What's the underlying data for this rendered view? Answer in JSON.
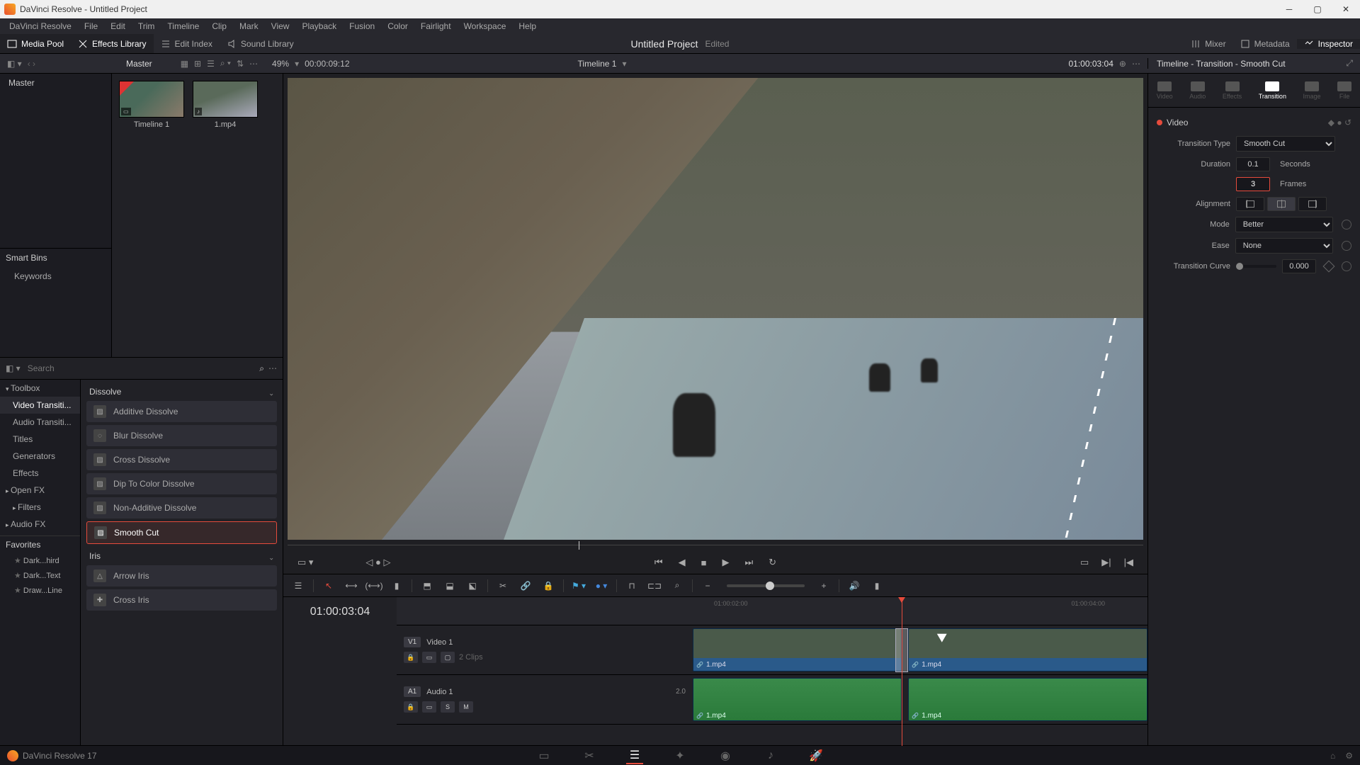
{
  "app": {
    "title": "DaVinci Resolve - Untitled Project",
    "project_name": "Untitled Project",
    "project_status": "Edited",
    "version": "DaVinci Resolve 17"
  },
  "menu": [
    "DaVinci Resolve",
    "File",
    "Edit",
    "Trim",
    "Timeline",
    "Clip",
    "Mark",
    "View",
    "Playback",
    "Fusion",
    "Color",
    "Fairlight",
    "Workspace",
    "Help"
  ],
  "topbar": {
    "media_pool": "Media Pool",
    "effects_library": "Effects Library",
    "edit_index": "Edit Index",
    "sound_library": "Sound Library",
    "mixer": "Mixer",
    "metadata": "Metadata",
    "inspector": "Inspector"
  },
  "header": {
    "master": "Master",
    "zoom_pct": "49%",
    "src_tc": "00:00:09:12",
    "timeline_name": "Timeline 1",
    "rec_tc": "01:00:03:04",
    "inspector_title": "Timeline - Transition - Smooth Cut"
  },
  "media": {
    "bin_root": "Master",
    "smart_bins": "Smart Bins",
    "keywords": "Keywords",
    "clips": [
      {
        "name": "Timeline 1",
        "type": "timeline"
      },
      {
        "name": "1.mp4",
        "type": "media"
      }
    ],
    "search_placeholder": "Search"
  },
  "fx": {
    "tree": {
      "toolbox": "Toolbox",
      "video_transitions": "Video Transiti...",
      "audio_transitions": "Audio Transiti...",
      "titles": "Titles",
      "generators": "Generators",
      "effects": "Effects",
      "openfx": "Open FX",
      "filters": "Filters",
      "audiofx": "Audio FX",
      "favorites": "Favorites",
      "fav_items": [
        "Dark...hird",
        "Dark...Text",
        "Draw...Line"
      ]
    },
    "groups": {
      "dissolve": "Dissolve",
      "dissolve_items": [
        "Additive Dissolve",
        "Blur Dissolve",
        "Cross Dissolve",
        "Dip To Color Dissolve",
        "Non-Additive Dissolve",
        "Smooth Cut"
      ],
      "iris": "Iris",
      "iris_items": [
        "Arrow Iris",
        "Cross Iris"
      ]
    },
    "selected": "Smooth Cut"
  },
  "timeline": {
    "current_tc": "01:00:03:04",
    "tick_labels": [
      "01:00:02:00",
      "01:00:04:00"
    ],
    "video_track": {
      "tag": "V1",
      "name": "Video 1",
      "clips_label": "2 Clips"
    },
    "audio_track": {
      "tag": "A1",
      "name": "Audio 1",
      "level": "2.0"
    },
    "clip1": "1.mp4",
    "clip2": "1.mp4"
  },
  "inspector": {
    "tabs": [
      "Video",
      "Audio",
      "Effects",
      "Transition",
      "Image",
      "File"
    ],
    "active_tab": "Transition",
    "group": "Video",
    "transition_type_label": "Transition Type",
    "transition_type": "Smooth Cut",
    "duration_label": "Duration",
    "duration_sec": "0.1",
    "seconds": "Seconds",
    "duration_frames": "3",
    "frames": "Frames",
    "alignment_label": "Alignment",
    "mode_label": "Mode",
    "mode": "Better",
    "ease_label": "Ease",
    "ease": "None",
    "curve_label": "Transition Curve",
    "curve_val": "0.000"
  },
  "pages": [
    "Media",
    "Cut",
    "Edit",
    "Fusion",
    "Color",
    "Fairlight",
    "Deliver"
  ]
}
